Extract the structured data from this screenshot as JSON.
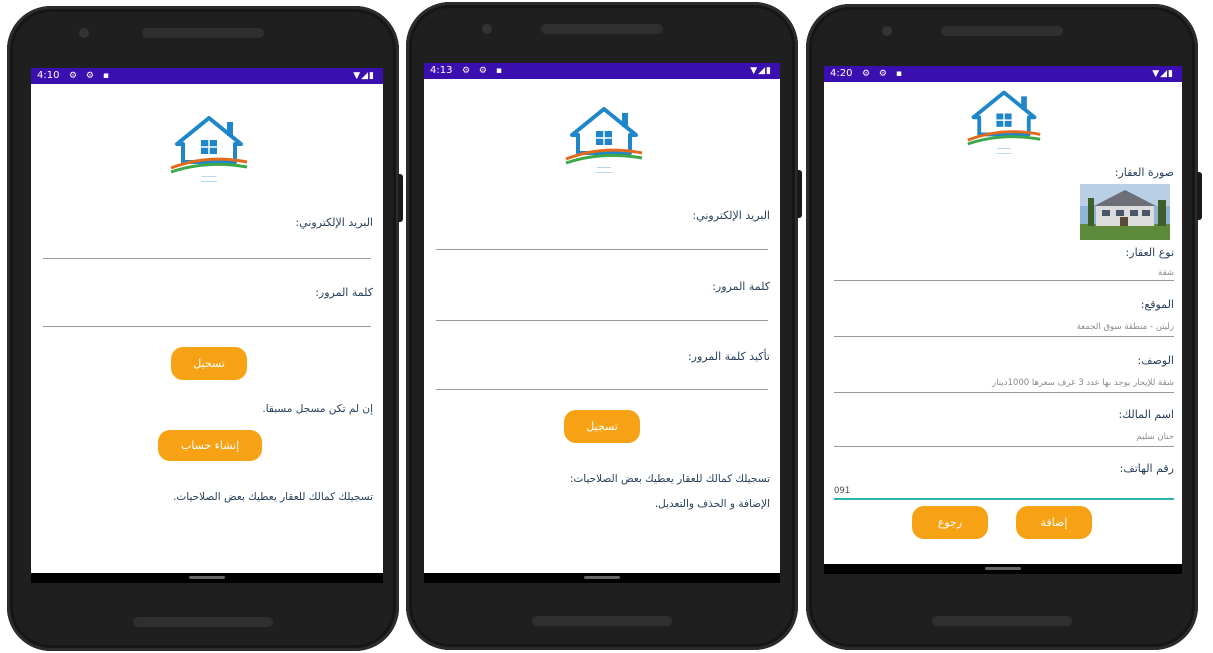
{
  "colors": {
    "status_bar": "#3a0fb0",
    "button": "#f6a214",
    "text": "#27415c"
  },
  "screen1": {
    "time": "4:10",
    "email_label": "البريد الإلكتروني:",
    "password_label": "كلمة المرور:",
    "login_button": "تسجيل",
    "no_account_text": "إن لم تكن مسجل مسبقا.",
    "create_account_button": "إنشاء حساب",
    "info_text": "تسجيلك كمالك للعقار يعطيك بعض الصلاحيات."
  },
  "screen2": {
    "time": "4:13",
    "email_label": "البريد الإلكتروني:",
    "password_label": "كلمة المرور:",
    "confirm_label": "تأكيد كلمة المرور:",
    "register_button": "تسجيل",
    "info_line1": "تسجيلك كمالك للعقار يعطيك بعض الصلاحيات:",
    "info_line2": "الإضافة و الحذف والتعديل."
  },
  "screen3": {
    "time": "4:20",
    "image_label": "صورة العقار:",
    "type_label": "نوع العقار:",
    "type_value": "شقة",
    "location_label": "الموقع:",
    "location_value": "زليتن - منطقة سوق الجمعة",
    "desc_label": "الوصف:",
    "desc_value": "شقة للإيجار يوجد بها عدد 3 غرف سعرها 1000دينار",
    "owner_label": "اسم المالك:",
    "owner_value": "حنان سليم",
    "phone_label": "رقم الهاتف:",
    "phone_value": "091",
    "add_button": "إضافة",
    "back_button": "رجوع"
  }
}
